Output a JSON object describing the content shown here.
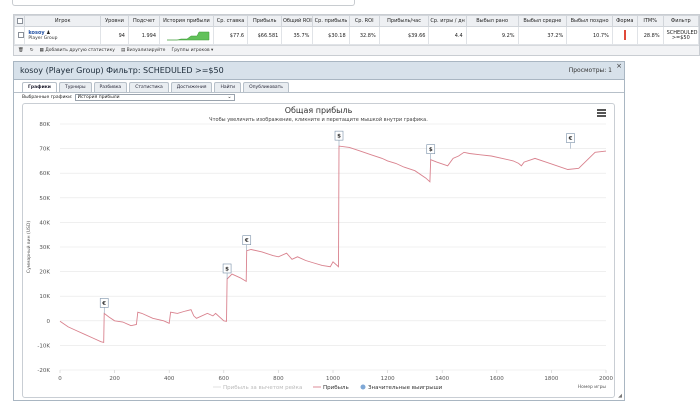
{
  "stats_table": {
    "headers": [
      "",
      "Игрок",
      "Уровни",
      "Подсчет",
      "История прибыли",
      "Ср. ставка",
      "Прибыль",
      "Общий ROI",
      "Ср. прибыль",
      "Ср. ROI",
      "Прибыль/час",
      "Ср. игры / дн",
      "Выбыл рано",
      "Выбыл средне",
      "Выбыл поздно",
      "Форма",
      "ITM%",
      "Фильтр"
    ],
    "row": {
      "player": "kosoy",
      "group": "Player Group",
      "levels": "94",
      "count": "1.994",
      "avg_stake": "$77.6",
      "profit": "$66.581",
      "total_roi": "35.7%",
      "avg_profit": "$30.18",
      "avg_roi": "32.8%",
      "profit_hour": "$39.66",
      "avg_games_day": "4.4",
      "early": "9.2%",
      "middle": "37.2%",
      "late": "10.7%",
      "itm": "28.8%",
      "filter": "SCHEDULED >=$50"
    },
    "footer": {
      "add_stats": "Добавить другую статистику",
      "visualize": "Визуализируйте",
      "player_groups": "Группы игроков ▾"
    }
  },
  "panel": {
    "title": "kosoy (Player Group) Фильтр: SCHEDULED >=$50",
    "views": "Просмотры: 1",
    "close": "×",
    "tabs": [
      "Графики",
      "Турниры",
      "Разбивка",
      "Статистика",
      "Достижения",
      "Найти",
      "Опубликовать"
    ],
    "select_label": "Выбранные графики:",
    "select_value": "История прибыли"
  },
  "chart_data": {
    "type": "line",
    "title": "Общая прибыль",
    "subtitle": "Чтобы увеличить изображение, кликните и перетащите мышкой внутри графика.",
    "ylabel": "Суммарный вин (USD)",
    "xlabel": "Номер игры",
    "xlim": [
      0,
      2000
    ],
    "ylim": [
      -20000,
      80000
    ],
    "x_ticks": [
      "0",
      "200",
      "400",
      "600",
      "800",
      "1000",
      "1200",
      "1400",
      "1600",
      "1800",
      "2000"
    ],
    "y_ticks": [
      "-20K",
      "-10K",
      "0",
      "10K",
      "20K",
      "30K",
      "40K",
      "50K",
      "60K",
      "70K",
      "80K"
    ],
    "legend": [
      "Прибыль за вычетом рейка",
      "Прибыль",
      "Значительные выигрыши"
    ],
    "series_color": "#d9828e",
    "series": [
      {
        "name": "Прибыль",
        "x": [
          0,
          30,
          60,
          90,
          120,
          150,
          160,
          162,
          180,
          200,
          230,
          260,
          280,
          285,
          300,
          340,
          380,
          400,
          405,
          430,
          460,
          480,
          490,
          500,
          540,
          560,
          570,
          600,
          610,
          612,
          630,
          660,
          682,
          684,
          700,
          740,
          780,
          800,
          830,
          850,
          870,
          900,
          930,
          960,
          990,
          1000,
          1020,
          1022,
          1060,
          1100,
          1140,
          1180,
          1200,
          1230,
          1260,
          1300,
          1340,
          1355,
          1358,
          1380,
          1420,
          1440,
          1460,
          1480,
          1500,
          1540,
          1580,
          1620,
          1660,
          1680,
          1690,
          1700,
          1740,
          1780,
          1820,
          1860,
          1900,
          1960,
          2000
        ],
        "y": [
          -200,
          -2500,
          -4000,
          -5500,
          -7000,
          -8500,
          -8800,
          3000,
          1500,
          0,
          -500,
          -2000,
          -1500,
          3500,
          3000,
          1000,
          0,
          -1000,
          3500,
          3000,
          4000,
          4500,
          2000,
          1000,
          3000,
          2000,
          3000,
          0,
          -200,
          17000,
          19000,
          17500,
          16000,
          28500,
          29000,
          28000,
          26500,
          26000,
          27500,
          25000,
          26000,
          24500,
          23500,
          22500,
          22000,
          24000,
          22000,
          71000,
          70500,
          69000,
          67500,
          66000,
          65000,
          64000,
          62500,
          61000,
          58000,
          56500,
          65500,
          64500,
          63000,
          66000,
          67000,
          68500,
          68000,
          67500,
          67000,
          66000,
          65000,
          64000,
          63000,
          64500,
          66000,
          64500,
          63000,
          61500,
          62000,
          68500,
          69000
        ]
      }
    ],
    "big_wins": [
      {
        "x": 162,
        "y": 3000,
        "label": "€"
      },
      {
        "x": 612,
        "y": 17000,
        "label": "$"
      },
      {
        "x": 684,
        "y": 28500,
        "label": "€"
      },
      {
        "x": 1022,
        "y": 71000,
        "label": "$"
      },
      {
        "x": 1358,
        "y": 65500,
        "label": "$"
      },
      {
        "x": 1870,
        "y": 70000,
        "label": "€"
      }
    ]
  }
}
